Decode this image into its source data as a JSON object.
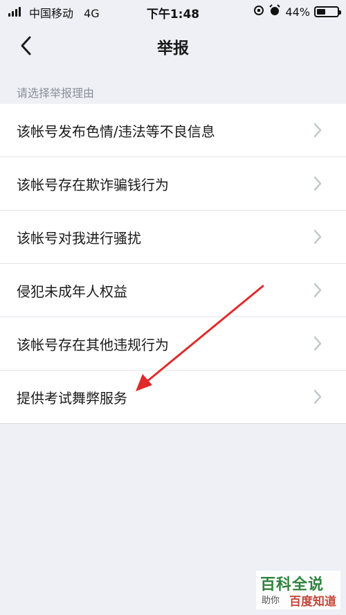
{
  "status_bar": {
    "carrier": "中国移动",
    "network": "4G",
    "time": "下午1:48",
    "battery_percent": "44%",
    "battery_level": 0.44
  },
  "nav": {
    "title": "举报"
  },
  "section": {
    "header": "请选择举报理由"
  },
  "reasons": [
    {
      "label": "该帐号发布色情/违法等不良信息"
    },
    {
      "label": "该帐号存在欺诈骗钱行为"
    },
    {
      "label": "该帐号对我进行骚扰"
    },
    {
      "label": "侵犯未成年人权益"
    },
    {
      "label": "该帐号存在其他违规行为"
    },
    {
      "label": "提供考试舞弊服务"
    }
  ],
  "annotation": {
    "arrow_color": "#e02a2a"
  },
  "watermark": {
    "title": "百科全说",
    "sub_left": "助你",
    "sub_right": "百度知道"
  }
}
